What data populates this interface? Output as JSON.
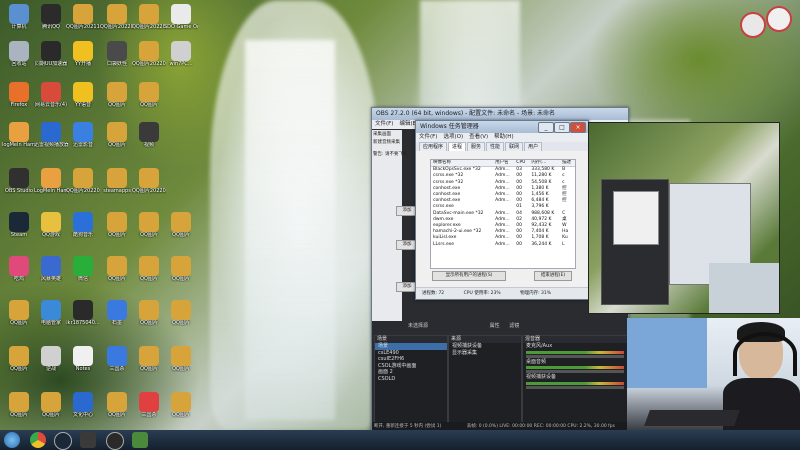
{
  "desktop_icons": [
    {
      "label": "计算机",
      "color": "#5a8fd0"
    },
    {
      "label": "腾讯QQ",
      "color": "#2b2b2b"
    },
    {
      "label": "QQ图片20211212...",
      "color": "#d6a43a"
    },
    {
      "label": "QQ图片20220316...",
      "color": "#d6a43a"
    },
    {
      "label": "QQ图片20220316...",
      "color": "#d6a43a"
    },
    {
      "label": "SDO Game Online",
      "color": "#eaeaea"
    },
    {
      "label": "回收站",
      "color": "#aab4c0"
    },
    {
      "label": "同期UU加速器",
      "color": "#2a2a2a"
    },
    {
      "label": "YY开播",
      "color": "#f0c020"
    },
    {
      "label": "口袋妖怪",
      "color": "#4a4a4a"
    },
    {
      "label": "QQ图片20220316...",
      "color": "#d6a43a"
    },
    {
      "label": "win7PC...",
      "color": "#d0d0d0"
    },
    {
      "label": "Firefox",
      "color": "#e8702a"
    },
    {
      "label": "网易云音乐(4)",
      "color": "#d84a3a"
    },
    {
      "label": "YY语音",
      "color": "#f0c020"
    },
    {
      "label": "QQ图片",
      "color": "#d6a43a"
    },
    {
      "label": "QQ图片",
      "color": "#d6a43a"
    },
    {
      "label": "logMeIn Hamachi",
      "color": "#e8a040"
    },
    {
      "label": "迅雷视频播放器",
      "color": "#2a6ad0"
    },
    {
      "label": "迅雷影音",
      "color": "#3a80e0"
    },
    {
      "label": "QQ图片",
      "color": "#d6a43a"
    },
    {
      "label": "视频",
      "color": "#3a3a3a"
    },
    {
      "label": "OBS Studio",
      "color": "#303030"
    },
    {
      "label": "LogMeIn Hamachi",
      "color": "#e8a040"
    },
    {
      "label": "QQ图片20220316...",
      "color": "#d6a43a"
    },
    {
      "label": "steamapps",
      "color": "#d6a43a"
    },
    {
      "label": "QQ图片20220316...",
      "color": "#d6a43a"
    },
    {
      "label": "Steam",
      "color": "#1b2838"
    },
    {
      "label": "QQ游戏",
      "color": "#e8c040"
    },
    {
      "label": "酷狗音乐",
      "color": "#2a70d8"
    },
    {
      "label": "QQ图片",
      "color": "#d6a43a"
    },
    {
      "label": "QQ图片",
      "color": "#d6a43a"
    },
    {
      "label": "QQ图片",
      "color": "#d6a43a"
    },
    {
      "label": "吃鸡",
      "color": "#e04a7a"
    },
    {
      "label": "风暴英雄",
      "color": "#3a6ad0"
    },
    {
      "label": "微信",
      "color": "#2aae3a"
    },
    {
      "label": "QQ图片",
      "color": "#d6a43a"
    },
    {
      "label": "QQ图片",
      "color": "#d6a43a"
    },
    {
      "label": "QQ图片",
      "color": "#d6a43a"
    },
    {
      "label": "QQ图片",
      "color": "#d6a43a"
    },
    {
      "label": "电脑管家",
      "color": "#3a8ad8"
    },
    {
      "label": "ikr1875040...",
      "color": "#2a2a2a"
    },
    {
      "label": "石墨",
      "color": "#3a7ae0"
    },
    {
      "label": "QQ图片",
      "color": "#d6a43a"
    },
    {
      "label": "QQ图片",
      "color": "#d6a43a"
    },
    {
      "label": "QQ图片",
      "color": "#d6a43a"
    },
    {
      "label": "逆战",
      "color": "#d0d0d0"
    },
    {
      "label": "Notes",
      "color": "#f0f0f0"
    },
    {
      "label": "三国杀",
      "color": "#3a7ae0"
    },
    {
      "label": "QQ图片",
      "color": "#d6a43a"
    },
    {
      "label": "QQ图片",
      "color": "#d6a43a"
    },
    {
      "label": "QQ图片",
      "color": "#d6a43a"
    },
    {
      "label": "QQ图片",
      "color": "#d6a43a"
    },
    {
      "label": "文化中心",
      "color": "#2a6ad0"
    },
    {
      "label": "QQ图片",
      "color": "#d6a43a"
    },
    {
      "label": "三国杀",
      "color": "#e04040"
    },
    {
      "label": "QQ图片",
      "color": "#d6a43a"
    },
    {
      "label": "QQ图片",
      "color": "#d6a43a"
    }
  ],
  "task_manager": {
    "title": "Windows 任务管理器",
    "menu": [
      "文件(F)",
      "选项(O)",
      "查看(V)",
      "帮助(H)"
    ],
    "tabs": [
      "应用程序",
      "进程",
      "服务",
      "性能",
      "联网",
      "用户"
    ],
    "columns": [
      "映像名称",
      "用户名",
      "CPU",
      "内存(...",
      "描述"
    ],
    "rows": [
      [
        "BlackOpsSvc.exe *32",
        "Adm...",
        "03",
        "333,580 K",
        "B"
      ],
      [
        "csrss.exe *32",
        "Adm...",
        "00",
        "11,280 K",
        "c"
      ],
      [
        "csrss.exe *32",
        "Adm...",
        "00",
        "54,508 K",
        "c"
      ],
      [
        "conhost.exe",
        "Adm...",
        "00",
        "1,380 K",
        "控"
      ],
      [
        "conhost.exe",
        "Adm...",
        "00",
        "1,456 K",
        "控"
      ],
      [
        "conhost.exe",
        "Adm...",
        "00",
        "6,484 K",
        "控"
      ],
      [
        "csrss.exe",
        "",
        "01",
        "3,796 K",
        ""
      ],
      [
        "DataSvc-main.exe *32",
        "Adm...",
        "04",
        "988,608 K",
        "C"
      ],
      [
        "dwm.exe",
        "Adm...",
        "02",
        "40,972 K",
        "桌"
      ],
      [
        "explorer.exe",
        "Adm...",
        "00",
        "92,432 K",
        "W"
      ],
      [
        "hamachi-2-ui.exe *32",
        "Adm...",
        "00",
        "7,404 K",
        "Ha"
      ],
      [
        "kuiLisl.exe",
        "Adm...",
        "00",
        "1,708 K",
        "Ku"
      ],
      [
        "LLsrs.exe",
        "Adm...",
        "00",
        "36,244 K",
        "L"
      ]
    ],
    "show_all_button": "显示所有用户的进程(S)",
    "end_button": "结束进程(E)",
    "status": {
      "processes": "进程数: 72",
      "cpu": "CPU 使用率: 23%",
      "memory": "物理内存: 31%"
    }
  },
  "obs": {
    "title": "OBS 27.2.0 (64 bit, windows) - 配置文件: 未命名 - 场景: 未命名",
    "menu": [
      "文件(F)",
      "编辑(E)",
      "视图(V)",
      "配置文件(P)",
      "场景集合(S)",
      "工具(T)",
      "帮助(H)"
    ],
    "left_items": [
      "采集画面",
      "新建音频采集",
      "添加..."
    ],
    "notice": "警告: 请不要飞机...",
    "side_buttons": [
      "添加",
      "添加",
      "添加",
      "添加"
    ],
    "bottom_tabs": [
      "未选择源",
      "属性",
      "滤镜"
    ],
    "scenes_header": "场景",
    "scenes": [
      "场景",
      "csLE490",
      "csuIE2FH6",
      "CSOL游戏中画面",
      "画面 2",
      "CSOLD"
    ],
    "sources_header": "来源",
    "sources": [
      "视频捕获设备",
      "显示器采集"
    ],
    "mixer_header": "混音器",
    "mixer_channels": [
      "麦克风/Aux",
      "桌面音频",
      "视频捕获设备"
    ],
    "status_bar": "丢帧: 0 (0.0%)   LIVE: 00:00:00   REC: 00:00:00   CPU: 2.2%, 30.00 fps",
    "status_left": "断开, 重新连接于 5 秒内 (尝试 1)"
  },
  "taskbar": {
    "icons": [
      "start",
      "chrome",
      "steam",
      "cs",
      "obs",
      "webcam",
      "kuma"
    ]
  },
  "top_right_icons": [
    "network-tray-icon",
    "app-tray-icon"
  ]
}
